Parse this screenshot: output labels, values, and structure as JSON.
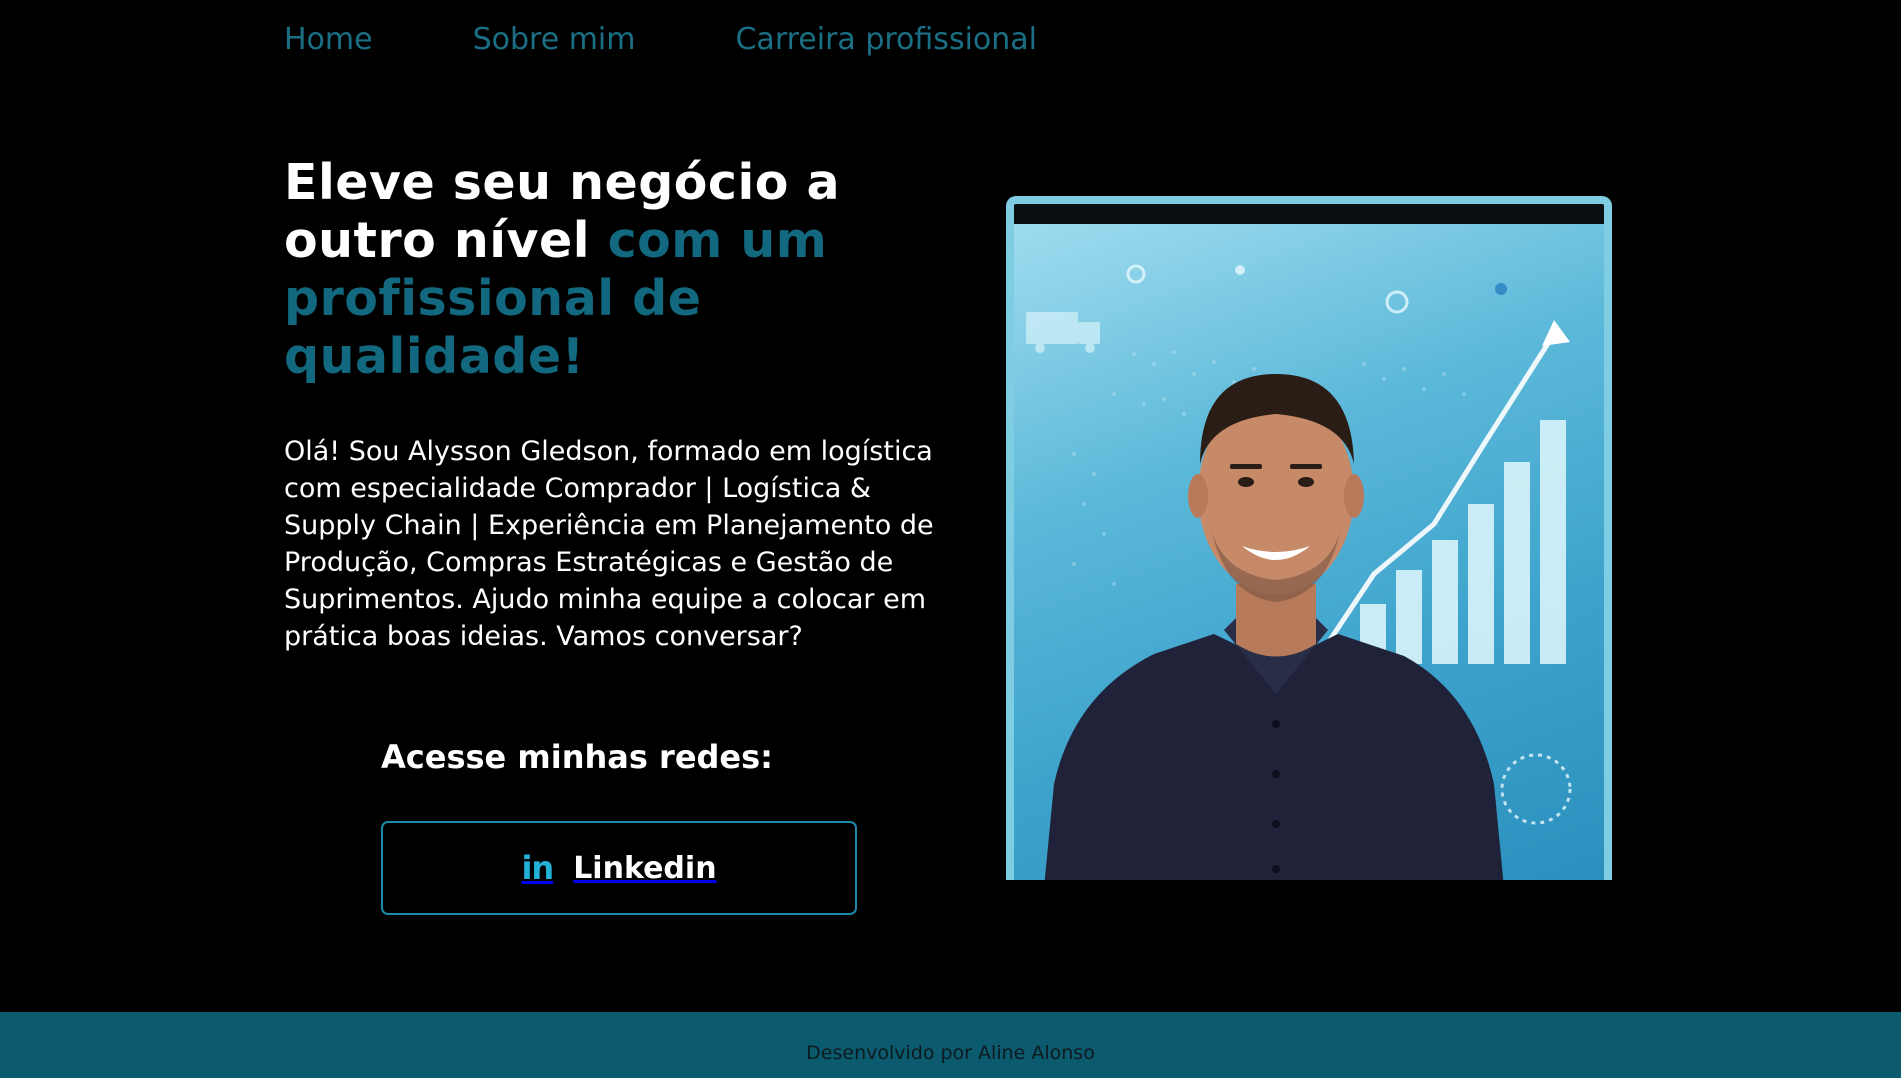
{
  "nav": {
    "items": [
      {
        "label": "Home"
      },
      {
        "label": "Sobre mim"
      },
      {
        "label": "Carreira profissional"
      }
    ]
  },
  "hero": {
    "headline_white": "Eleve seu negócio a outro nível",
    "headline_accent": "com um profissional de qualidade!",
    "bio": "Olá! Sou Alysson Gledson, formado em logística com especialidade Comprador | Logística & Supply Chain | Experiência em Planejamento de Produção, Compras Estratégicas e Gestão de Suprimentos. Ajudo minha equipe a colocar em prática boas ideias. Vamos conversar?",
    "social_heading": "Acesse minhas redes:",
    "linkedin": {
      "icon_text": "in",
      "label": "Linkedin",
      "icon": "linkedin-icon"
    },
    "photo": {
      "description_icon": "profile-photo"
    }
  },
  "footer": {
    "credit": "Desenvolvido por Aline Alonso"
  },
  "colors": {
    "background": "#000000",
    "accent": "#12697f",
    "nav": "#1b6f85",
    "frame": "#7fcde3",
    "button_border": "#1c8aa8",
    "footer": "#0b5a6e"
  }
}
